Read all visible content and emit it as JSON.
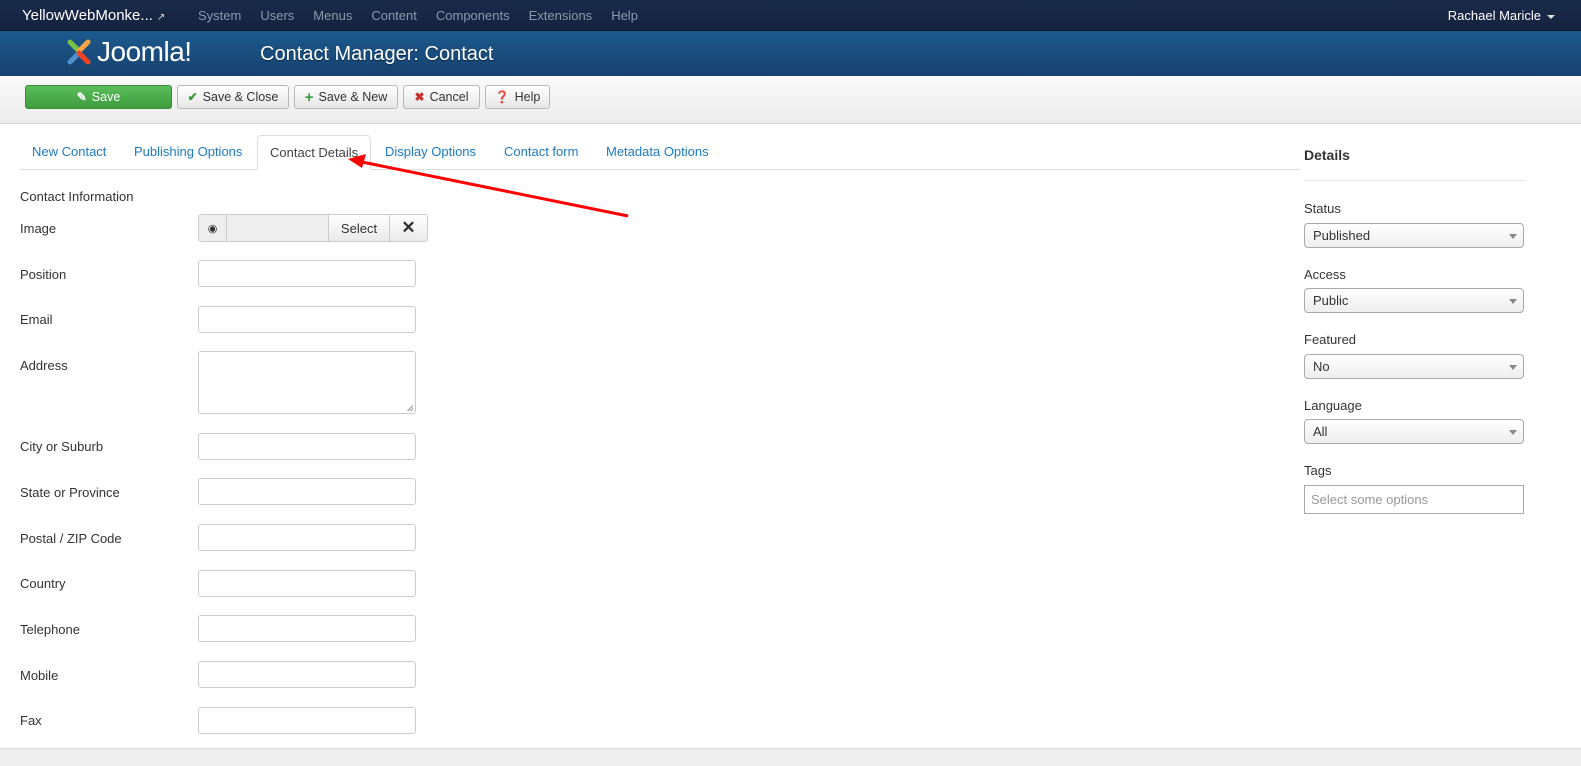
{
  "topnav": {
    "site_name": "YellowWebMonke...",
    "menu": [
      "System",
      "Users",
      "Menus",
      "Content",
      "Components",
      "Extensions",
      "Help"
    ],
    "user": "Rachael Maricle"
  },
  "header": {
    "logo_text": "Joomla!",
    "title": "Contact Manager: Contact"
  },
  "toolbar": {
    "save": "Save",
    "save_close": "Save & Close",
    "save_new": "Save & New",
    "cancel": "Cancel",
    "help": "Help"
  },
  "tabs": [
    {
      "label": "New Contact",
      "active": false
    },
    {
      "label": "Publishing Options",
      "active": false
    },
    {
      "label": "Contact Details",
      "active": true
    },
    {
      "label": "Display Options",
      "active": false
    },
    {
      "label": "Contact form",
      "active": false
    },
    {
      "label": "Metadata Options",
      "active": false
    }
  ],
  "form": {
    "section_title": "Contact Information",
    "image_label": "Image",
    "image_select": "Select",
    "fields": [
      {
        "label": "Position",
        "value": ""
      },
      {
        "label": "Email",
        "value": ""
      },
      {
        "label": "Address",
        "value": ""
      },
      {
        "label": "City or Suburb",
        "value": ""
      },
      {
        "label": "State or Province",
        "value": ""
      },
      {
        "label": "Postal / ZIP Code",
        "value": ""
      },
      {
        "label": "Country",
        "value": ""
      },
      {
        "label": "Telephone",
        "value": ""
      },
      {
        "label": "Mobile",
        "value": ""
      },
      {
        "label": "Fax",
        "value": ""
      }
    ]
  },
  "sidebar": {
    "title": "Details",
    "status": {
      "label": "Status",
      "value": "Published"
    },
    "access": {
      "label": "Access",
      "value": "Public"
    },
    "featured": {
      "label": "Featured",
      "value": "No"
    },
    "language": {
      "label": "Language",
      "value": "All"
    },
    "tags": {
      "label": "Tags",
      "placeholder": "Select some options"
    }
  },
  "colors": {
    "topnav_bg": "#1a2a4a",
    "header_bg": "#1c5a8e",
    "save_green": "#4cae4c",
    "tab_link": "#1f7ac2",
    "annotation_arrow": "#ff0000"
  }
}
